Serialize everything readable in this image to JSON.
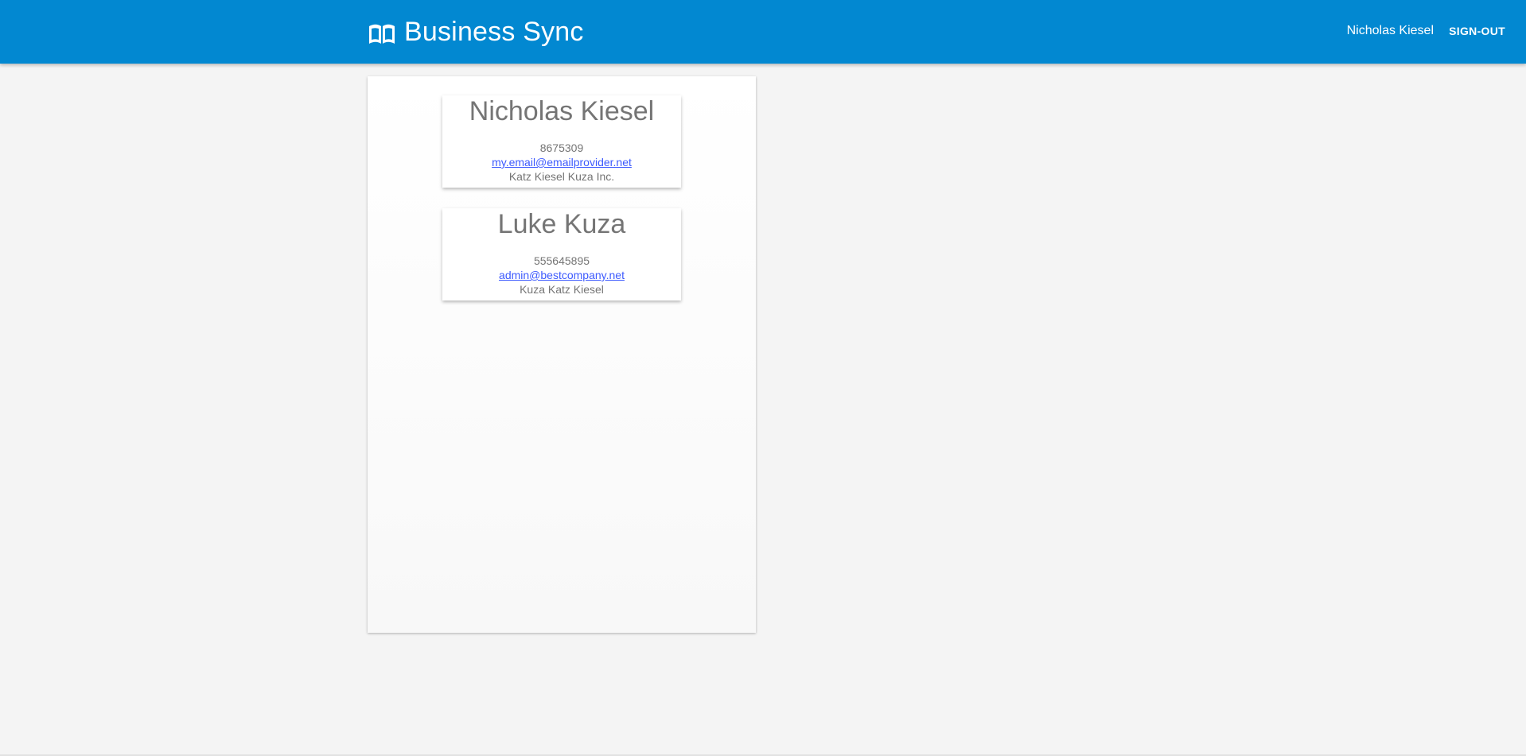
{
  "header": {
    "brand_title": "Business Sync",
    "brand_icon": "book-open-icon",
    "user_name": "Nicholas Kiesel",
    "sign_out_label": "SIGN-OUT",
    "bar_color": "#0288d1"
  },
  "contacts": [
    {
      "name": "Nicholas Kiesel",
      "phone": "8675309",
      "email": "my.email@emailprovider.net",
      "company": "Katz Kiesel Kuza Inc."
    },
    {
      "name": "Luke Kuza",
      "phone": "555645895",
      "email": "admin@bestcompany.net",
      "company": "Kuza Katz Kiesel"
    }
  ],
  "colors": {
    "link": "#3d5afe",
    "text_muted": "#757575",
    "background": "#f4f4f4"
  }
}
